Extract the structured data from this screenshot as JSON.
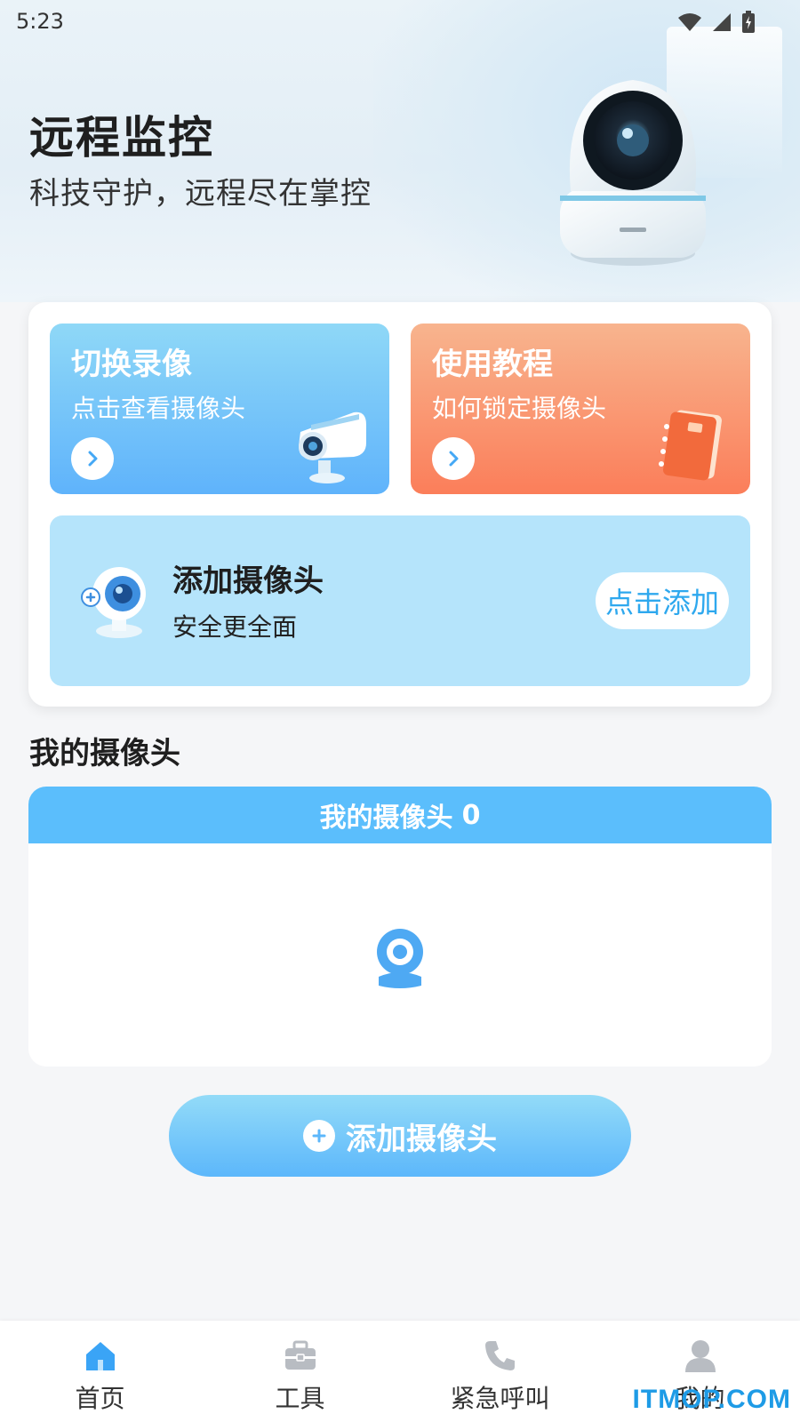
{
  "status_bar": {
    "time": "5:23"
  },
  "hero": {
    "title": "远程监控",
    "subtitle": "科技守护，远程尽在掌控"
  },
  "feature_tiles": [
    {
      "title": "切换录像",
      "subtitle": "点击查看摄像头",
      "color": "#5fb3fb"
    },
    {
      "title": "使用教程",
      "subtitle": "如何锁定摄像头",
      "color": "#fb7e5a"
    }
  ],
  "add_panel": {
    "title": "添加摄像头",
    "subtitle": "安全更全面",
    "button_label": "点击添加"
  },
  "my_cameras": {
    "section_title": "我的摄像头",
    "list_header_label": "我的摄像头",
    "count": "0"
  },
  "add_camera_button": "添加摄像头",
  "bottom_nav": [
    {
      "label": "首页",
      "icon": "home-icon",
      "active": true
    },
    {
      "label": "工具",
      "icon": "toolbox-icon",
      "active": false
    },
    {
      "label": "紧急呼叫",
      "icon": "phone-icon",
      "active": false
    },
    {
      "label": "我的",
      "icon": "user-icon",
      "active": false
    }
  ],
  "watermark": "ITMOP.COM",
  "colors": {
    "accent_blue": "#5bbefc",
    "accent_orange": "#fb7e5a",
    "link_blue": "#2ea8ee"
  }
}
